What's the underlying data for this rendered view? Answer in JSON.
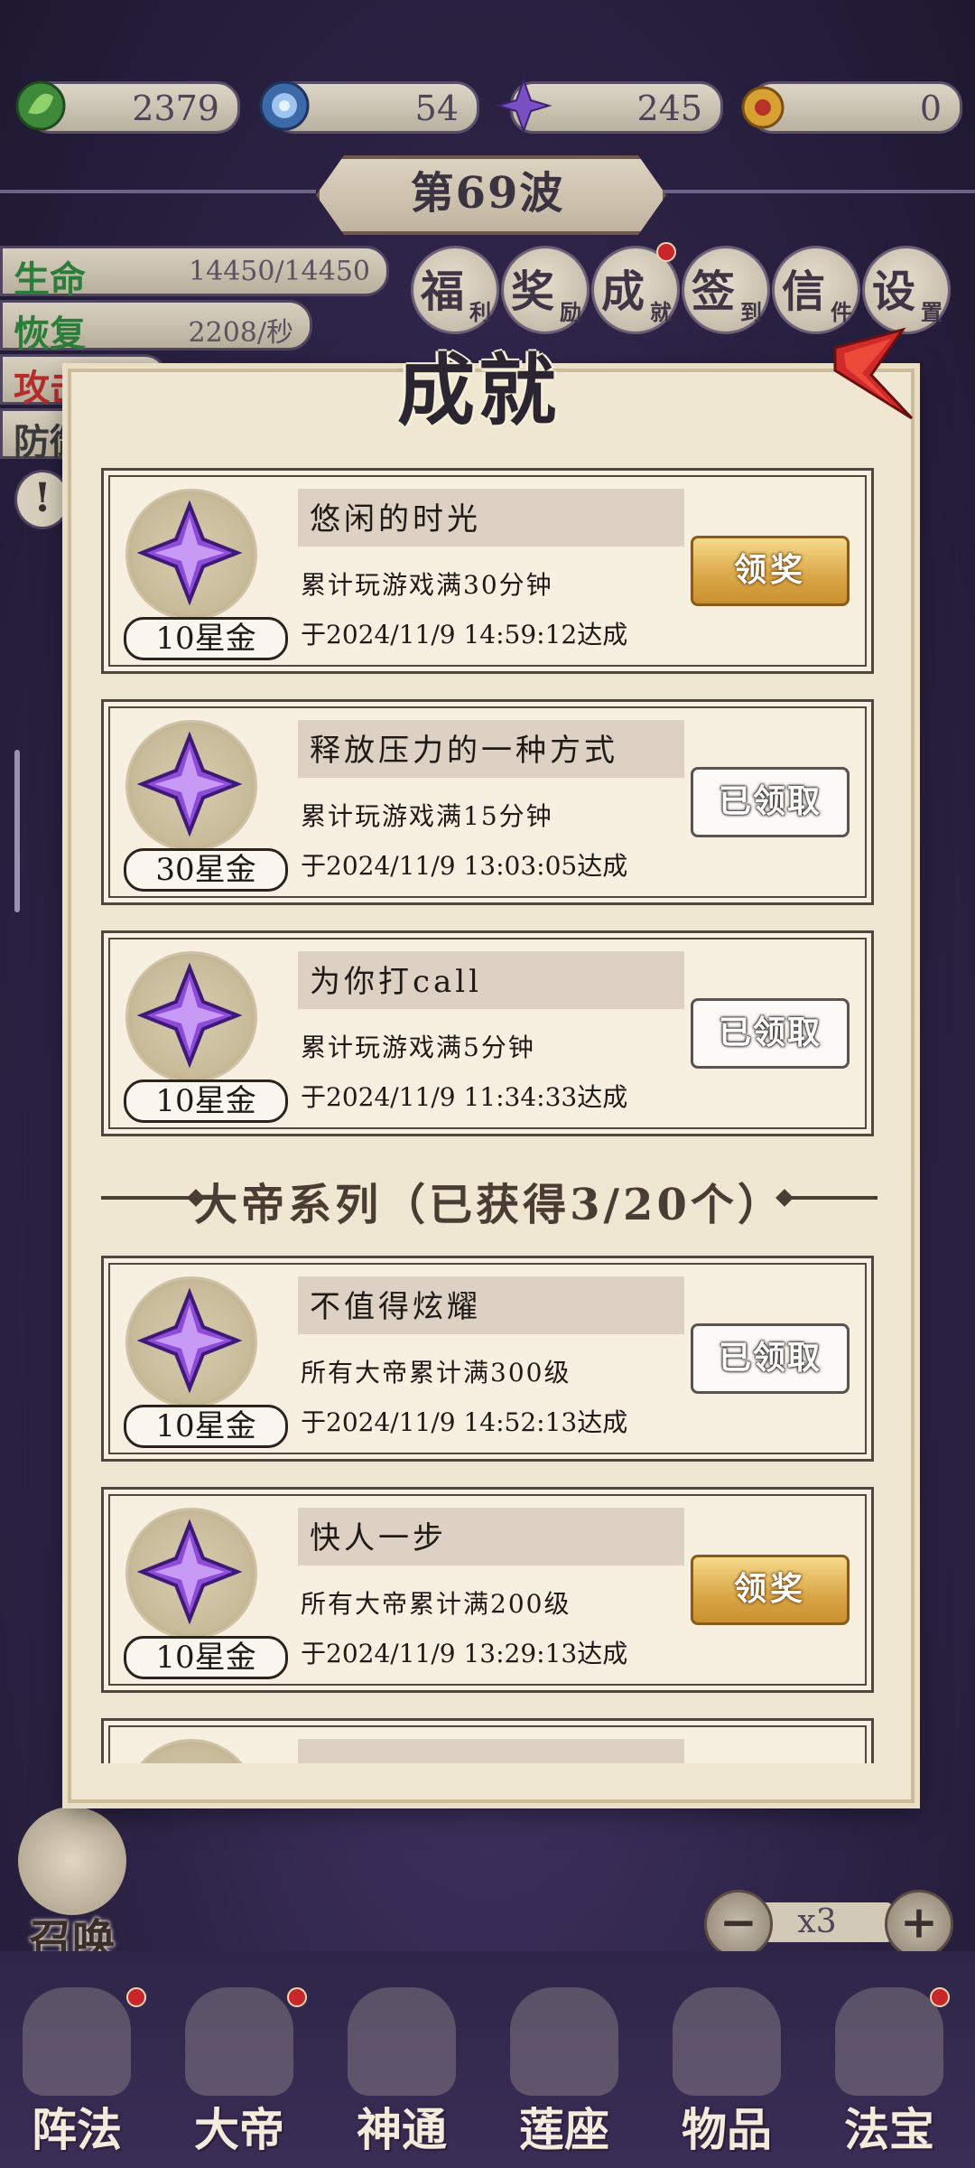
{
  "resources": [
    {
      "icon": "leaf-gem-icon",
      "value": "2379"
    },
    {
      "icon": "blue-orb-icon",
      "value": "54"
    },
    {
      "icon": "purple-star-icon",
      "value": "245"
    },
    {
      "icon": "gold-treasure-icon",
      "value": "0"
    }
  ],
  "wave": "第69波",
  "stats": [
    {
      "label": "生命",
      "value": "14450/14450"
    },
    {
      "label": "恢复",
      "value": "2208/秒"
    },
    {
      "label": "攻击",
      "value": ""
    },
    {
      "label": "防御",
      "value": ""
    }
  ],
  "menu": [
    {
      "c1": "福",
      "c2": "利",
      "dot": false
    },
    {
      "c1": "奖",
      "c2": "励",
      "dot": false
    },
    {
      "c1": "成",
      "c2": "就",
      "dot": true
    },
    {
      "c1": "签",
      "c2": "到",
      "dot": false
    },
    {
      "c1": "信",
      "c2": "件",
      "dot": false
    },
    {
      "c1": "设",
      "c2": "置",
      "dot": false
    }
  ],
  "modal": {
    "title": "成就",
    "section_title": "大帝系列（已获得3/20个）",
    "claim_label": "领奖",
    "claimed_label": "已领取"
  },
  "achievements": [
    {
      "name": "悠闲的时光",
      "desc": "累计玩游戏满30分钟",
      "date": "于2024/11/9 14:59:12达成",
      "reward": "10星金",
      "status": "claim"
    },
    {
      "name": "释放压力的一种方式",
      "desc": "累计玩游戏满15分钟",
      "date": "于2024/11/9 13:03:05达成",
      "reward": "30星金",
      "status": "claimed"
    },
    {
      "name": "为你打call",
      "desc": "累计玩游戏满5分钟",
      "date": "于2024/11/9 11:34:33达成",
      "reward": "10星金",
      "status": "claimed"
    },
    {
      "name": "不值得炫耀",
      "desc": "所有大帝累计满300级",
      "date": "于2024/11/9 14:52:13达成",
      "reward": "10星金",
      "status": "claimed"
    },
    {
      "name": "快人一步",
      "desc": "所有大帝累计满200级",
      "date": "于2024/11/9 13:29:13达成",
      "reward": "10星金",
      "status": "claim"
    }
  ],
  "speed": {
    "minus": "−",
    "value": "x3",
    "plus": "+"
  },
  "summon_label": "召唤",
  "nav": [
    {
      "label": "阵法",
      "dot": true
    },
    {
      "label": "大帝",
      "dot": true
    },
    {
      "label": "神通",
      "dot": false
    },
    {
      "label": "莲座",
      "dot": false
    },
    {
      "label": "物品",
      "dot": false
    },
    {
      "label": "法宝",
      "dot": true
    }
  ]
}
